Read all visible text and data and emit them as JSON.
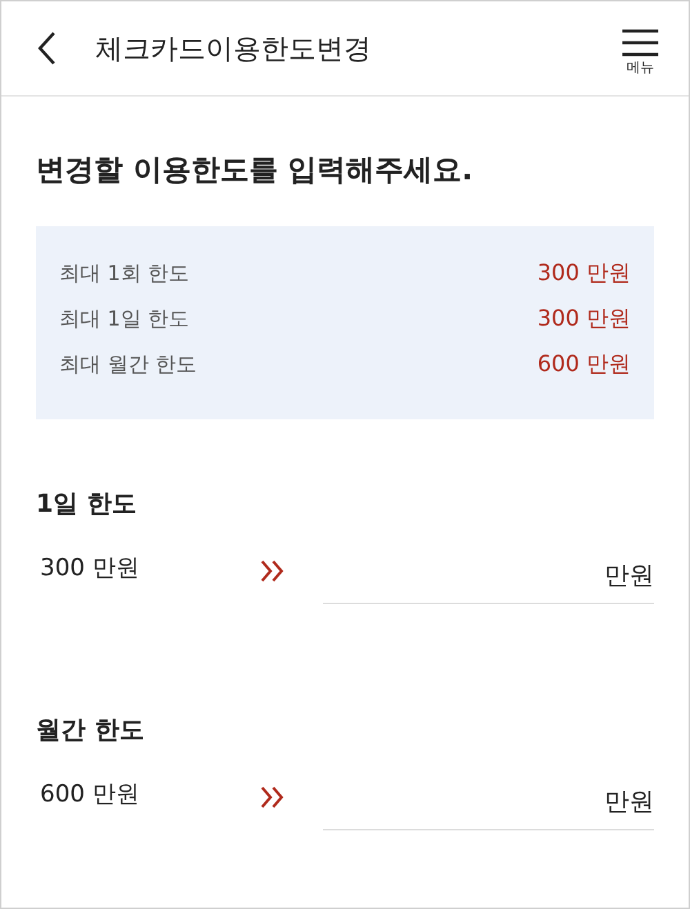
{
  "header": {
    "title": "체크카드이용한도변경",
    "menu_label": "메뉴"
  },
  "heading": "변경할 이용한도를 입력해주세요.",
  "limits_info": [
    {
      "label": "최대 1회 한도",
      "value": "300 만원"
    },
    {
      "label": "최대 1일 한도",
      "value": "300 만원"
    },
    {
      "label": "최대 월간 한도",
      "value": "600 만원"
    }
  ],
  "sections": [
    {
      "title": "1일 한도",
      "current": "300 만원",
      "unit": "만원"
    },
    {
      "title": "월간 한도",
      "current": "600 만원",
      "unit": "만원"
    }
  ]
}
